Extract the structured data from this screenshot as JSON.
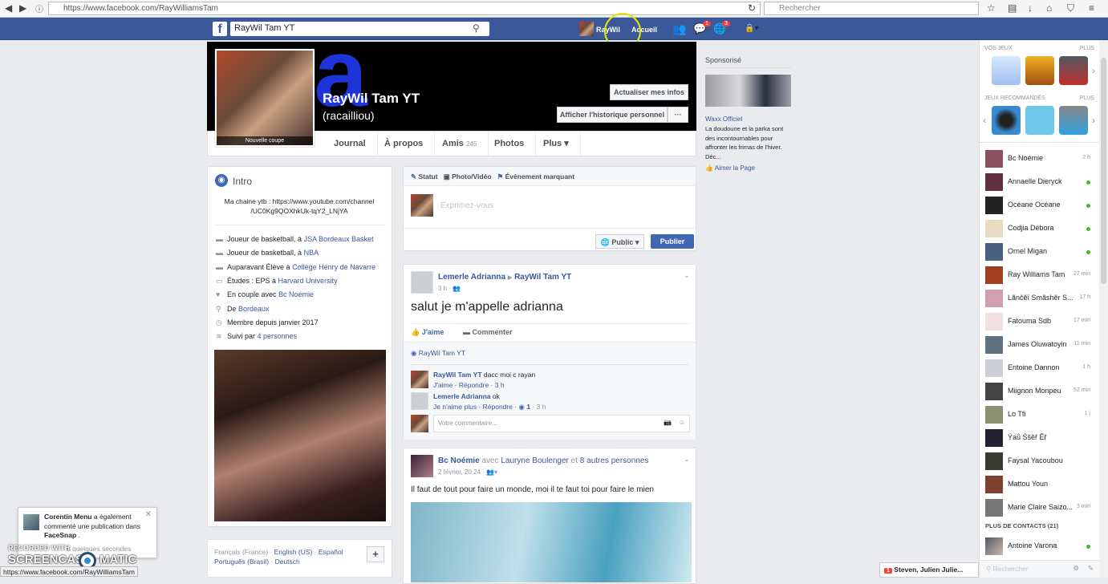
{
  "browser": {
    "url": "https://www.facebook.com/RayWilliamsTam",
    "search_placeholder": "Rechercher"
  },
  "topbar": {
    "search_value": "RayWil Tam YT",
    "user_short": "RayWil",
    "home": "Accueil",
    "friend_requests_badge": "",
    "messages_badge": "1",
    "notifications_badge": "3"
  },
  "profile": {
    "name": "RayWil Tam YT",
    "nickname": "(racailliou)",
    "pic_caption": "Nouvelle coupe",
    "update_info": "Actualiser mes infos",
    "activity_log": "Afficher l'historique personnel",
    "more_dots": "···",
    "cover_text": "na"
  },
  "tabs": [
    {
      "label": "Journal"
    },
    {
      "label": "À propos"
    },
    {
      "label": "Amis",
      "count": "245"
    },
    {
      "label": "Photos"
    },
    {
      "label": "Plus ▾"
    }
  ],
  "intro": {
    "title": "Intro",
    "bio": "Ma chaine ytb : https://www.youtube.com/channel /UC0Kg9QOXhkUk-tqY2_LNjYA",
    "items": [
      {
        "text": "Joueur de basketball, à ",
        "link": "JSA Bordeaux Basket"
      },
      {
        "text": "Joueur de basketball, à ",
        "link": "NBA"
      },
      {
        "text": "Auparavant Élève à ",
        "link": "Collège Henry de Navarre"
      },
      {
        "text": "Études : EPS à ",
        "link": "Harvard University"
      },
      {
        "text": "En couple avec ",
        "link": "Bc Noémie"
      },
      {
        "text": "De ",
        "link": "Bordeaux"
      },
      {
        "text": "Membre depuis janvier 2017",
        "link": ""
      },
      {
        "text": "Suivi par ",
        "link": "4 personnes"
      }
    ]
  },
  "languages": {
    "current": "Français (France)",
    "options": [
      "English (US)",
      "Español",
      "Português (Brasil)",
      "Deutsch"
    ],
    "add": "+"
  },
  "composer": {
    "tabs": [
      "Statut",
      "Photo/Vidéo",
      "Évènement marquant"
    ],
    "placeholder": "Exprimez-vous",
    "privacy": "Public ▾",
    "publish": "Publier"
  },
  "post1": {
    "author": "Lemerle Adrianna",
    "target": "RayWil Tam YT",
    "time": "3 h",
    "text": "salut je m'appelle adrianna",
    "like": "J'aime",
    "comment": "Commenter",
    "liked_by": "RayWil Tam YT",
    "comments": [
      {
        "author": "RayWil Tam YT",
        "text": "dacc moi c rayan",
        "actions": "J'aime · Répondre · 3 h"
      },
      {
        "author": "Lemerle Adrianna",
        "text": "ok",
        "actions": "Je n'aime plus · Répondre · ",
        "likes": "1",
        "time": " · 3 h"
      }
    ],
    "comment_placeholder": "Votre commentaire..."
  },
  "post2": {
    "author": "Bc Noémie",
    "with": "avec",
    "tagged": "Lauryne Boulenger",
    "and": "et",
    "others": "8 autres personnes",
    "time": "2 février, 20:24",
    "text": "Il faut de tout pour faire un monde, moi il te faut toi pour faire le mien"
  },
  "sponsored": {
    "title": "Sponsorisé",
    "advertiser": "Waxx Officiel",
    "text": "La doudoune et la parka sont des incontournables pour affronter les frimas de l'hiver. Déc...",
    "like_page": "Aimer la Page"
  },
  "games": {
    "your_games": "VOS JEUX",
    "recommended": "JEUX RECOMMANDÉS",
    "more": "PLUS"
  },
  "contacts": [
    {
      "name": "Bc Noémie",
      "time": "2 h"
    },
    {
      "name": "Annaelle Dieryck",
      "online": true
    },
    {
      "name": "Océane Océane",
      "online": true
    },
    {
      "name": "Codjia Débora",
      "online": true
    },
    {
      "name": "Ornel Migan",
      "online": true
    },
    {
      "name": "Ray Williams Tam",
      "time": "27 min"
    },
    {
      "name": "Lãnčěï Smãshěr S...",
      "time": "17 h"
    },
    {
      "name": "Fatouma Sdb",
      "time": "17 min"
    },
    {
      "name": "James Oluwatoyin",
      "time": "11 min"
    },
    {
      "name": "Entoine Dannon",
      "time": "1 h"
    },
    {
      "name": "Miignon Monpeu",
      "time": "52 min"
    },
    {
      "name": "Lo Tfi",
      "time": "1 j"
    },
    {
      "name": "Ýaů Śšěř Ěř",
      "time": ""
    },
    {
      "name": "Faysal Yacoubou",
      "time": ""
    },
    {
      "name": "Mattou Youn",
      "time": ""
    },
    {
      "name": "Marie Claire Saizo...",
      "time": "3 min"
    }
  ],
  "more_contacts": {
    "label": "PLUS DE CONTACTS (21)",
    "items": [
      {
        "name": "Antoine Varona",
        "online": true
      }
    ]
  },
  "chat_search": "Rechercher",
  "chat_tab": {
    "count": "1",
    "label": "Steven, Julien Julie..."
  },
  "notification": {
    "author": "Corentin Menu",
    "text": " a également commenté une publication dans ",
    "app": "FaceSnap",
    "time": "à quelques secondes"
  },
  "watermark": {
    "line1": "RECORDED WITH",
    "line2": "SCREENCAST",
    "line3": "MATIC"
  },
  "status_url": "https://www.facebook.com/RayWilliamsTam"
}
